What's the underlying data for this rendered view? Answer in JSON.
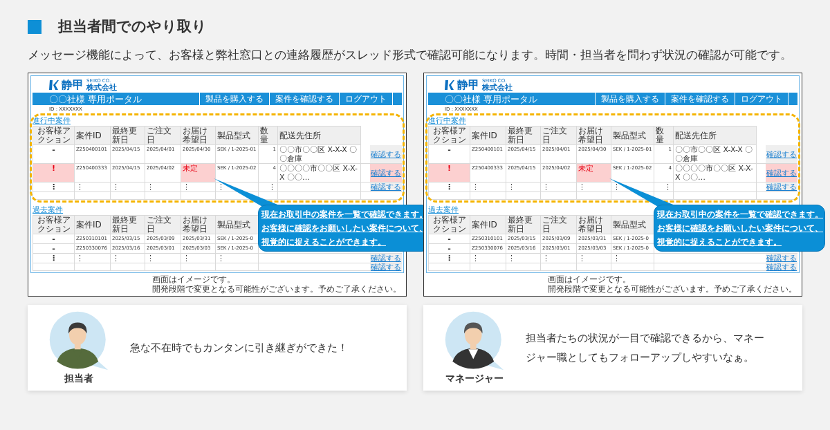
{
  "heading": {
    "title": "担当者間でのやり取り"
  },
  "intro": "メッセージ機能によって、お客様と弊社窓口との連絡履歴がスレッド形式で確認可能になります。時間・担当者を問わず状況の確認が可能です。",
  "mockups": [
    {
      "logo": {
        "name": "静甲",
        "latin": "SEIKO CO.",
        "suffix": "株式会社"
      },
      "portal_title": "〇〇社様 専用ポータル",
      "nav": [
        "製品を購入する",
        "案件を確認する",
        "ログアウト"
      ],
      "user_id": "ID : XXXXXXX",
      "active_cases": {
        "title": "進行中案件",
        "columns": [
          "お客様アクション",
          "案件ID",
          "最終更新日",
          "ご注文日",
          "お届け希望日",
          "製品型式",
          "数量",
          "配送先住所"
        ],
        "rows": [
          {
            "kind": "data",
            "flagged": false,
            "cells": [
              "-",
              "Z250400101",
              "2025/04/15",
              "2025/04/01",
              "2025/04/30",
              "SEK / 1-2025-01",
              "1",
              "〇〇市〇〇区 X-X-X 〇〇倉庫"
            ],
            "action": "確認する"
          },
          {
            "kind": "data",
            "flagged": true,
            "cells": [
              "!",
              "Z250400333",
              "2025/04/15",
              "2025/04/02",
              "未定",
              "SEK / 1-2025-02",
              "4",
              "〇〇〇〇市〇〇区 X-X-X 〇〇…"
            ],
            "action": "確認する"
          },
          {
            "kind": "data",
            "flagged": false,
            "cells": [
              "⋮",
              "⋮",
              "⋮",
              "⋮",
              "⋮",
              "⋮",
              "⋮"
            ],
            "action": "確認する"
          },
          {
            "kind": "blank",
            "flagged": false
          }
        ]
      },
      "past_cases": {
        "title": "過去案件",
        "columns": [
          "お客様アクション",
          "案件ID",
          "最終更新日",
          "ご注文日",
          "お届け希望日",
          "製品型式"
        ],
        "rows": [
          {
            "kind": "data",
            "flagged": false,
            "cells": [
              "-",
              "Z250310101",
              "2025/03/15",
              "2025/03/09",
              "2025/03/31",
              "SEK / 1-2025-0"
            ]
          },
          {
            "kind": "data",
            "flagged": false,
            "cells": [
              "-",
              "Z250330076",
              "2025/03/16",
              "2025/03/01",
              "2025/03/03",
              "SEK / 1-2025-0"
            ]
          },
          {
            "kind": "data",
            "flagged": false,
            "cells": [
              "⋮",
              "⋮",
              "⋮",
              "⋮",
              "⋮",
              "⋮"
            ],
            "action": "確認する"
          },
          {
            "kind": "blank",
            "flagged": false,
            "action": "確認する"
          }
        ]
      },
      "callout": [
        "現在お取引中の案件を一覧で確認できます。",
        "お客様に確認をお願いしたい案件について、",
        "視覚的に捉えることができます。"
      ],
      "footnote": [
        "画面はイメージです。",
        "開発段階で変更となる可能性がございます。予めご了承ください。"
      ]
    },
    {
      "logo": {
        "name": "静甲",
        "latin": "SEIKO CO.",
        "suffix": "株式会社"
      },
      "portal_title": "〇〇社様 専用ポータル",
      "nav": [
        "製品を購入する",
        "案件を確認する",
        "ログアウト"
      ],
      "user_id": "ID : XXXXXXX",
      "active_cases": {
        "title": "進行中案件",
        "columns": [
          "お客様アクション",
          "案件ID",
          "最終更新日",
          "ご注文日",
          "お届け希望日",
          "製品型式",
          "数量",
          "配送先住所"
        ],
        "rows": [
          {
            "kind": "data",
            "flagged": false,
            "cells": [
              "-",
              "Z250400101",
              "2025/04/15",
              "2025/04/01",
              "2025/04/30",
              "SEK / 1-2025-01",
              "1",
              "〇〇市〇〇区 X-X-X 〇〇倉庫"
            ],
            "action": "確認する"
          },
          {
            "kind": "data",
            "flagged": true,
            "cells": [
              "!",
              "Z250400333",
              "2025/04/15",
              "2025/04/02",
              "未定",
              "SEK / 1-2025-02",
              "4",
              "〇〇〇〇市〇〇区 X-X-X 〇〇…"
            ],
            "action": "確認する"
          },
          {
            "kind": "data",
            "flagged": false,
            "cells": [
              "⋮",
              "⋮",
              "⋮",
              "⋮",
              "⋮",
              "⋮",
              "⋮"
            ],
            "action": "確認する"
          },
          {
            "kind": "blank",
            "flagged": false
          }
        ]
      },
      "past_cases": {
        "title": "過去案件",
        "columns": [
          "お客様アクション",
          "案件ID",
          "最終更新日",
          "ご注文日",
          "お届け希望日",
          "製品型式"
        ],
        "rows": [
          {
            "kind": "data",
            "flagged": false,
            "cells": [
              "-",
              "Z250310101",
              "2025/03/15",
              "2025/03/09",
              "2025/03/31",
              "SEK / 1-2025-0"
            ]
          },
          {
            "kind": "data",
            "flagged": false,
            "cells": [
              "-",
              "Z250330076",
              "2025/03/16",
              "2025/03/01",
              "2025/03/03",
              "SEK / 1-2025-0"
            ]
          },
          {
            "kind": "data",
            "flagged": false,
            "cells": [
              "⋮",
              "⋮",
              "⋮",
              "⋮",
              "⋮",
              "⋮"
            ],
            "action": "確認する"
          },
          {
            "kind": "blank",
            "flagged": false,
            "action": "確認する"
          }
        ]
      },
      "callout": [
        "現在お取引中の案件を一覧で確認できます。",
        "お客様に確認をお願いしたい案件について、",
        "視覚的に捉えることができます。"
      ],
      "footnote": [
        "画面はイメージです。",
        "開発段階で変更となる可能性がございます。予めご了承ください。"
      ]
    }
  ],
  "testimonials": [
    {
      "kind": "staff",
      "role": "担当者",
      "quote": "急な不在時でもカンタンに引き継ぎができた！"
    },
    {
      "kind": "manager",
      "role": "マネージャー",
      "quote": "担当者たちの状況が一目で確認できるから、マネージャー職としてもフォローアップしやすいなぁ。"
    }
  ]
}
